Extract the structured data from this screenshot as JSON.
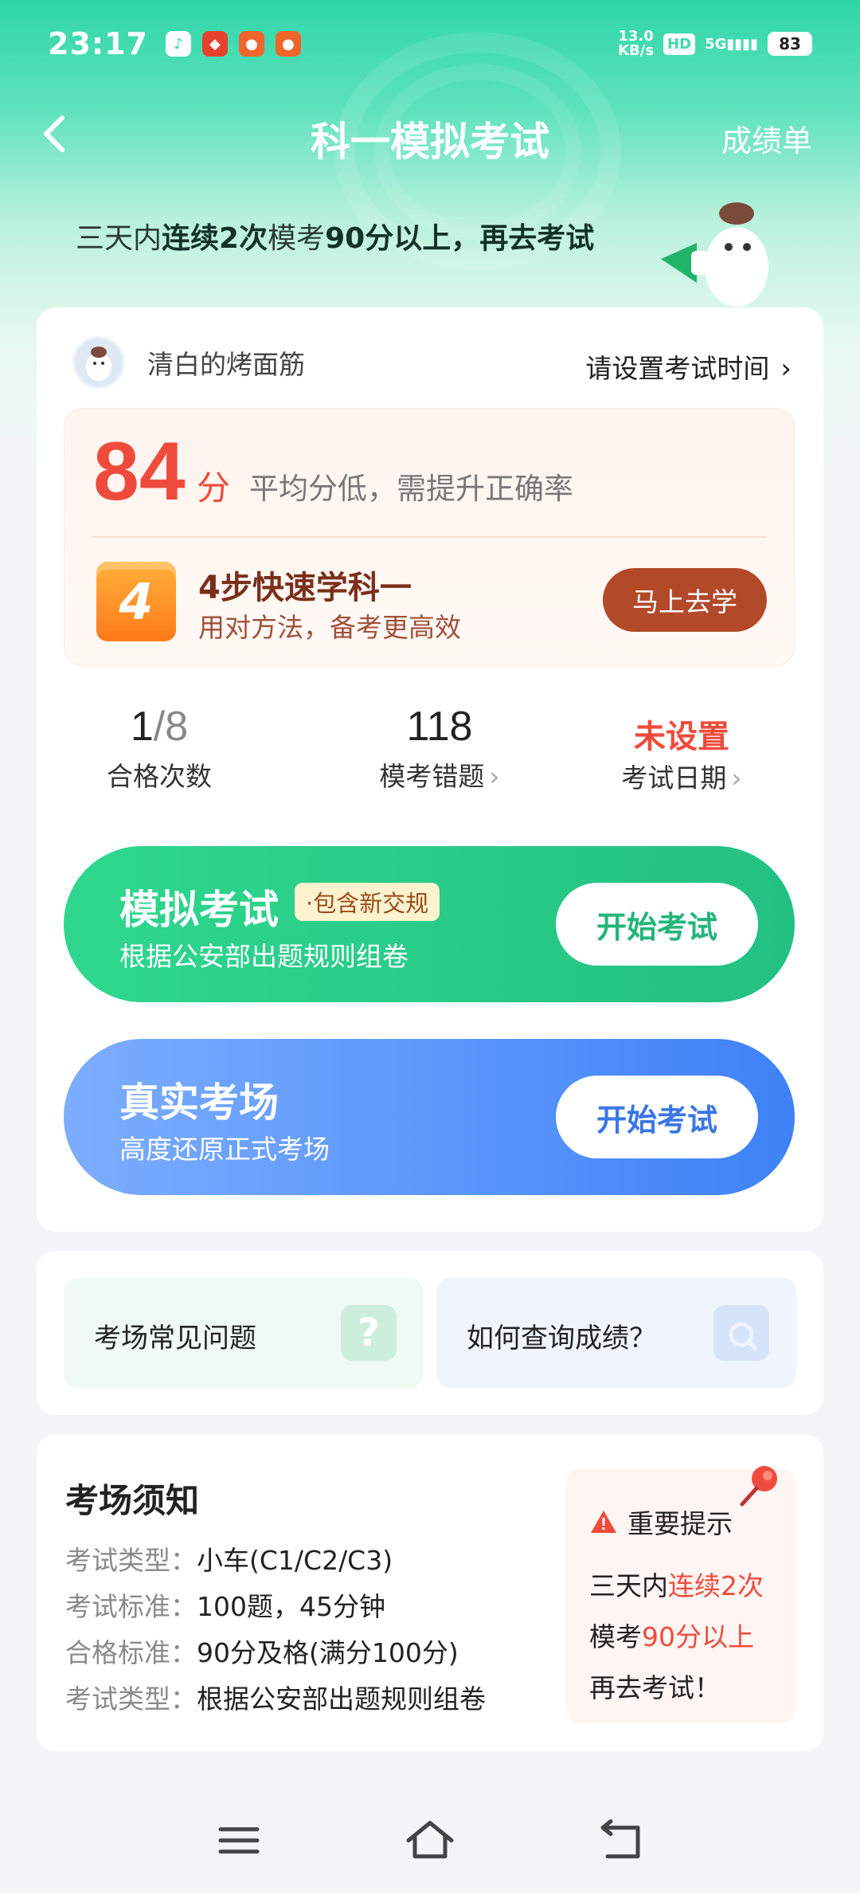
{
  "status": {
    "time": "23:17",
    "speed_value": "13.0",
    "speed_unit": "KB/s",
    "hd": "HD",
    "network": "5G",
    "battery": "83"
  },
  "nav": {
    "title": "科一模拟考试",
    "right": "成绩单"
  },
  "banner": {
    "p1": "三天内",
    "b1": "连续2次",
    "p2": "模考",
    "b2": "90分以上，再去考试"
  },
  "user": {
    "name": "清白的烤面筋",
    "set_time": "请设置考试时间"
  },
  "score": {
    "value": "84",
    "unit": "分",
    "hint": "平均分低，需提升正确率"
  },
  "steps": {
    "icon_text": "4",
    "title": "4步快速学科一",
    "subtitle": "用对方法，备考更高效",
    "button": "马上去学"
  },
  "stats": [
    {
      "value_main": "1",
      "value_dim": "/8",
      "label": "合格次数"
    },
    {
      "value_main": "118",
      "label": "模考错题"
    },
    {
      "value_main": "未设置",
      "label": "考试日期"
    }
  ],
  "exams": [
    {
      "title": "模拟考试",
      "tag": "·包含新交规",
      "subtitle": "根据公安部出题规则组卷",
      "button": "开始考试"
    },
    {
      "title": "真实考场",
      "subtitle": "高度还原正式考场",
      "button": "开始考试"
    }
  ],
  "faq": [
    {
      "label": "考场常见问题",
      "icon": "question-icon"
    },
    {
      "label": "如何查询成绩？",
      "icon": "search-score-icon"
    }
  ],
  "notice": {
    "title": "考场须知",
    "rows": [
      {
        "k": "考试类型：",
        "v": "小车(C1/C2/C3)"
      },
      {
        "k": "考试标准：",
        "v": "100题，45分钟"
      },
      {
        "k": "合格标准：",
        "v": "90分及格(满分100分)"
      },
      {
        "k": "考试类型：",
        "v": "根据公安部出题规则组卷"
      }
    ],
    "tip": {
      "head": "重要提示",
      "l1a": "三天内",
      "l1b": "连续2次",
      "l2a": "模考",
      "l2b": "90分以上",
      "l3": "再去考试！"
    }
  },
  "colors": {
    "brand_green": "#23c083",
    "accent_red": "#ef4b3c",
    "blue": "#3e82f7",
    "learn_button": "#b24a2a"
  }
}
